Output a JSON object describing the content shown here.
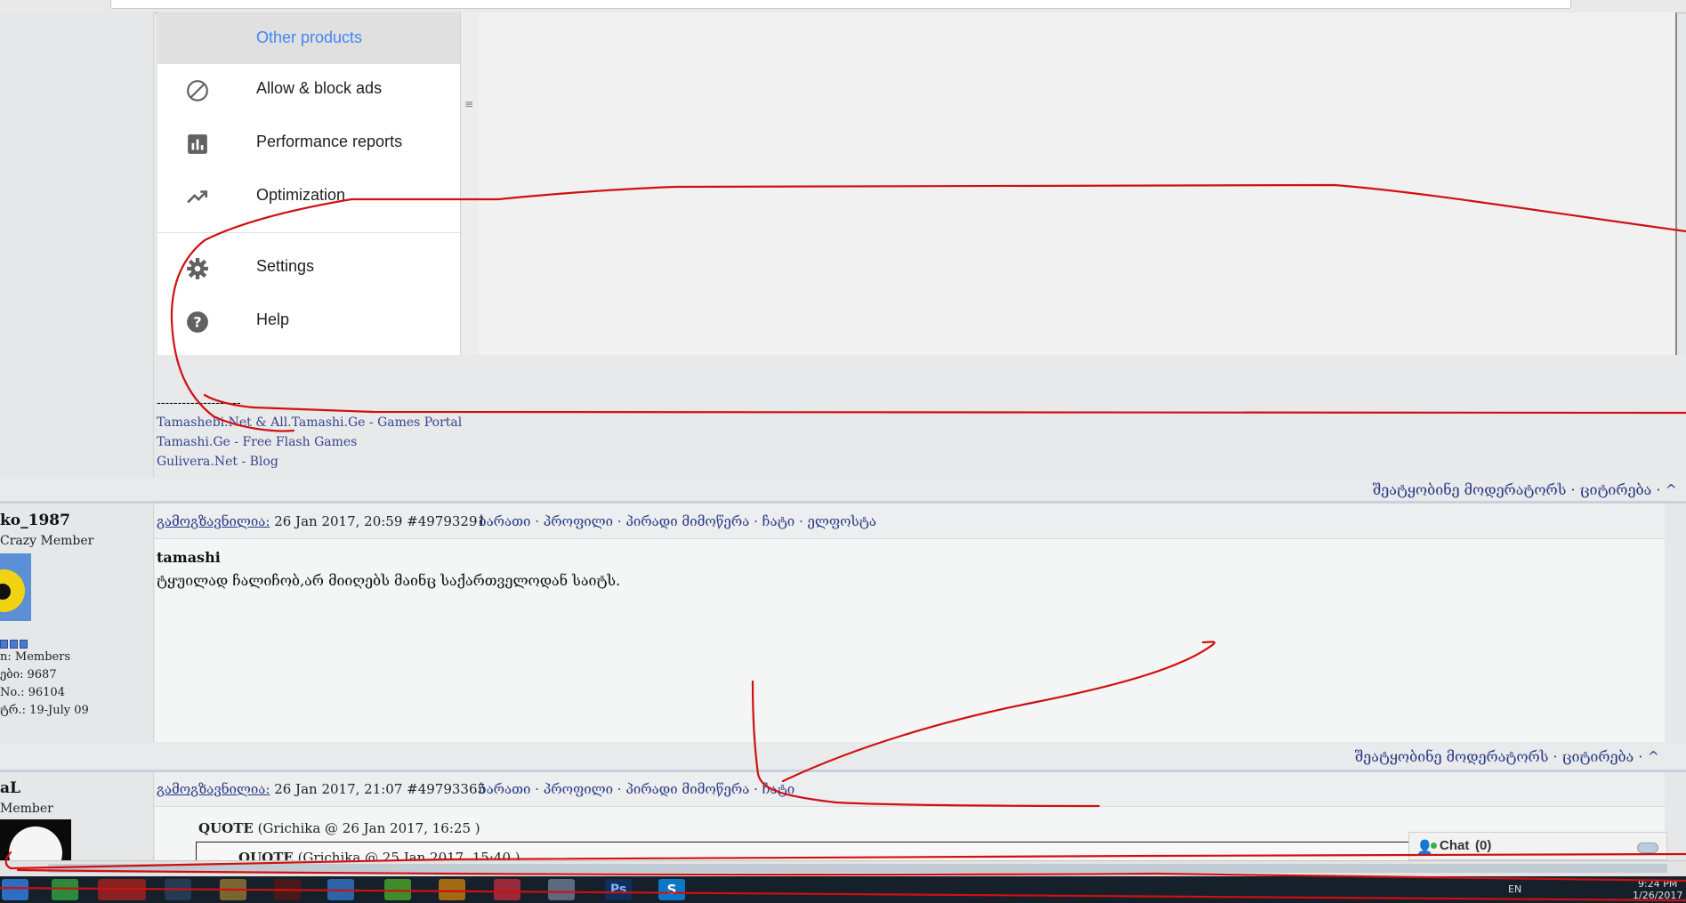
{
  "menu": {
    "other_products": "Other products",
    "items": [
      {
        "label": "Allow & block ads",
        "icon": "block-icon"
      },
      {
        "label": "Performance reports",
        "icon": "bar-chart-icon"
      },
      {
        "label": "Optimization",
        "icon": "trending-up-icon"
      },
      {
        "label": "Settings",
        "icon": "gear-icon"
      },
      {
        "label": "Help",
        "icon": "help-icon"
      }
    ]
  },
  "signature": {
    "dashes": "--------------------",
    "links": [
      "Tamashebi.Net & All.Tamashi.Ge - Games Portal",
      "Tamashi.Ge - Free Flash Games",
      "Gulivera.Net - Blog"
    ]
  },
  "actions_row1": "შეატყობინე მოდერატორს  · ციტირება · ^",
  "post1": {
    "author": "ko_1987",
    "rank": "Crazy Member",
    "group": "n: Members",
    "posts": "ები: 9687",
    "number": "No.: 96104",
    "reg": "ტრ.: 19-July 09",
    "sent_label": "გამოგზავნილია:",
    "date": " 26 Jan 2017, 20:59  #49793291",
    "links": "ბარათი · პროფილი · პირადი მიმოწერა · ჩატი · ელფოსტა",
    "title": "tamashi",
    "body": "ტყუილად ჩალიჩობ,არ მიიღებს მაინც საქართველოდან საიტს.",
    "actions": "შეატყობინე მოდერატორს  · ციტირება · ^"
  },
  "post2": {
    "author": "aL",
    "rank": "Member",
    "sent_label": "გამოგზავნილია:",
    "date": " 26 Jan 2017, 21:07  #49793365",
    "links": "ბარათი · პროფილი · პირადი მიმოწერა · ჩატი",
    "quote_label": "QUOTE",
    "quote_src": " (Grichika @ 26 Jan 2017, 16:25 )",
    "quote2_label": "QUOTE",
    "quote2_src": " (Grichika @ 25 Jan 2017, 15:40 )"
  },
  "chat": {
    "label": "Chat",
    "count": "(0)"
  },
  "tray": {
    "lang": "EN",
    "time": "9:24 PM",
    "date": "1/26/2017"
  },
  "colors": {
    "accent": "#4285f4",
    "link": "#2a3a86",
    "annotation": "#d01010"
  }
}
